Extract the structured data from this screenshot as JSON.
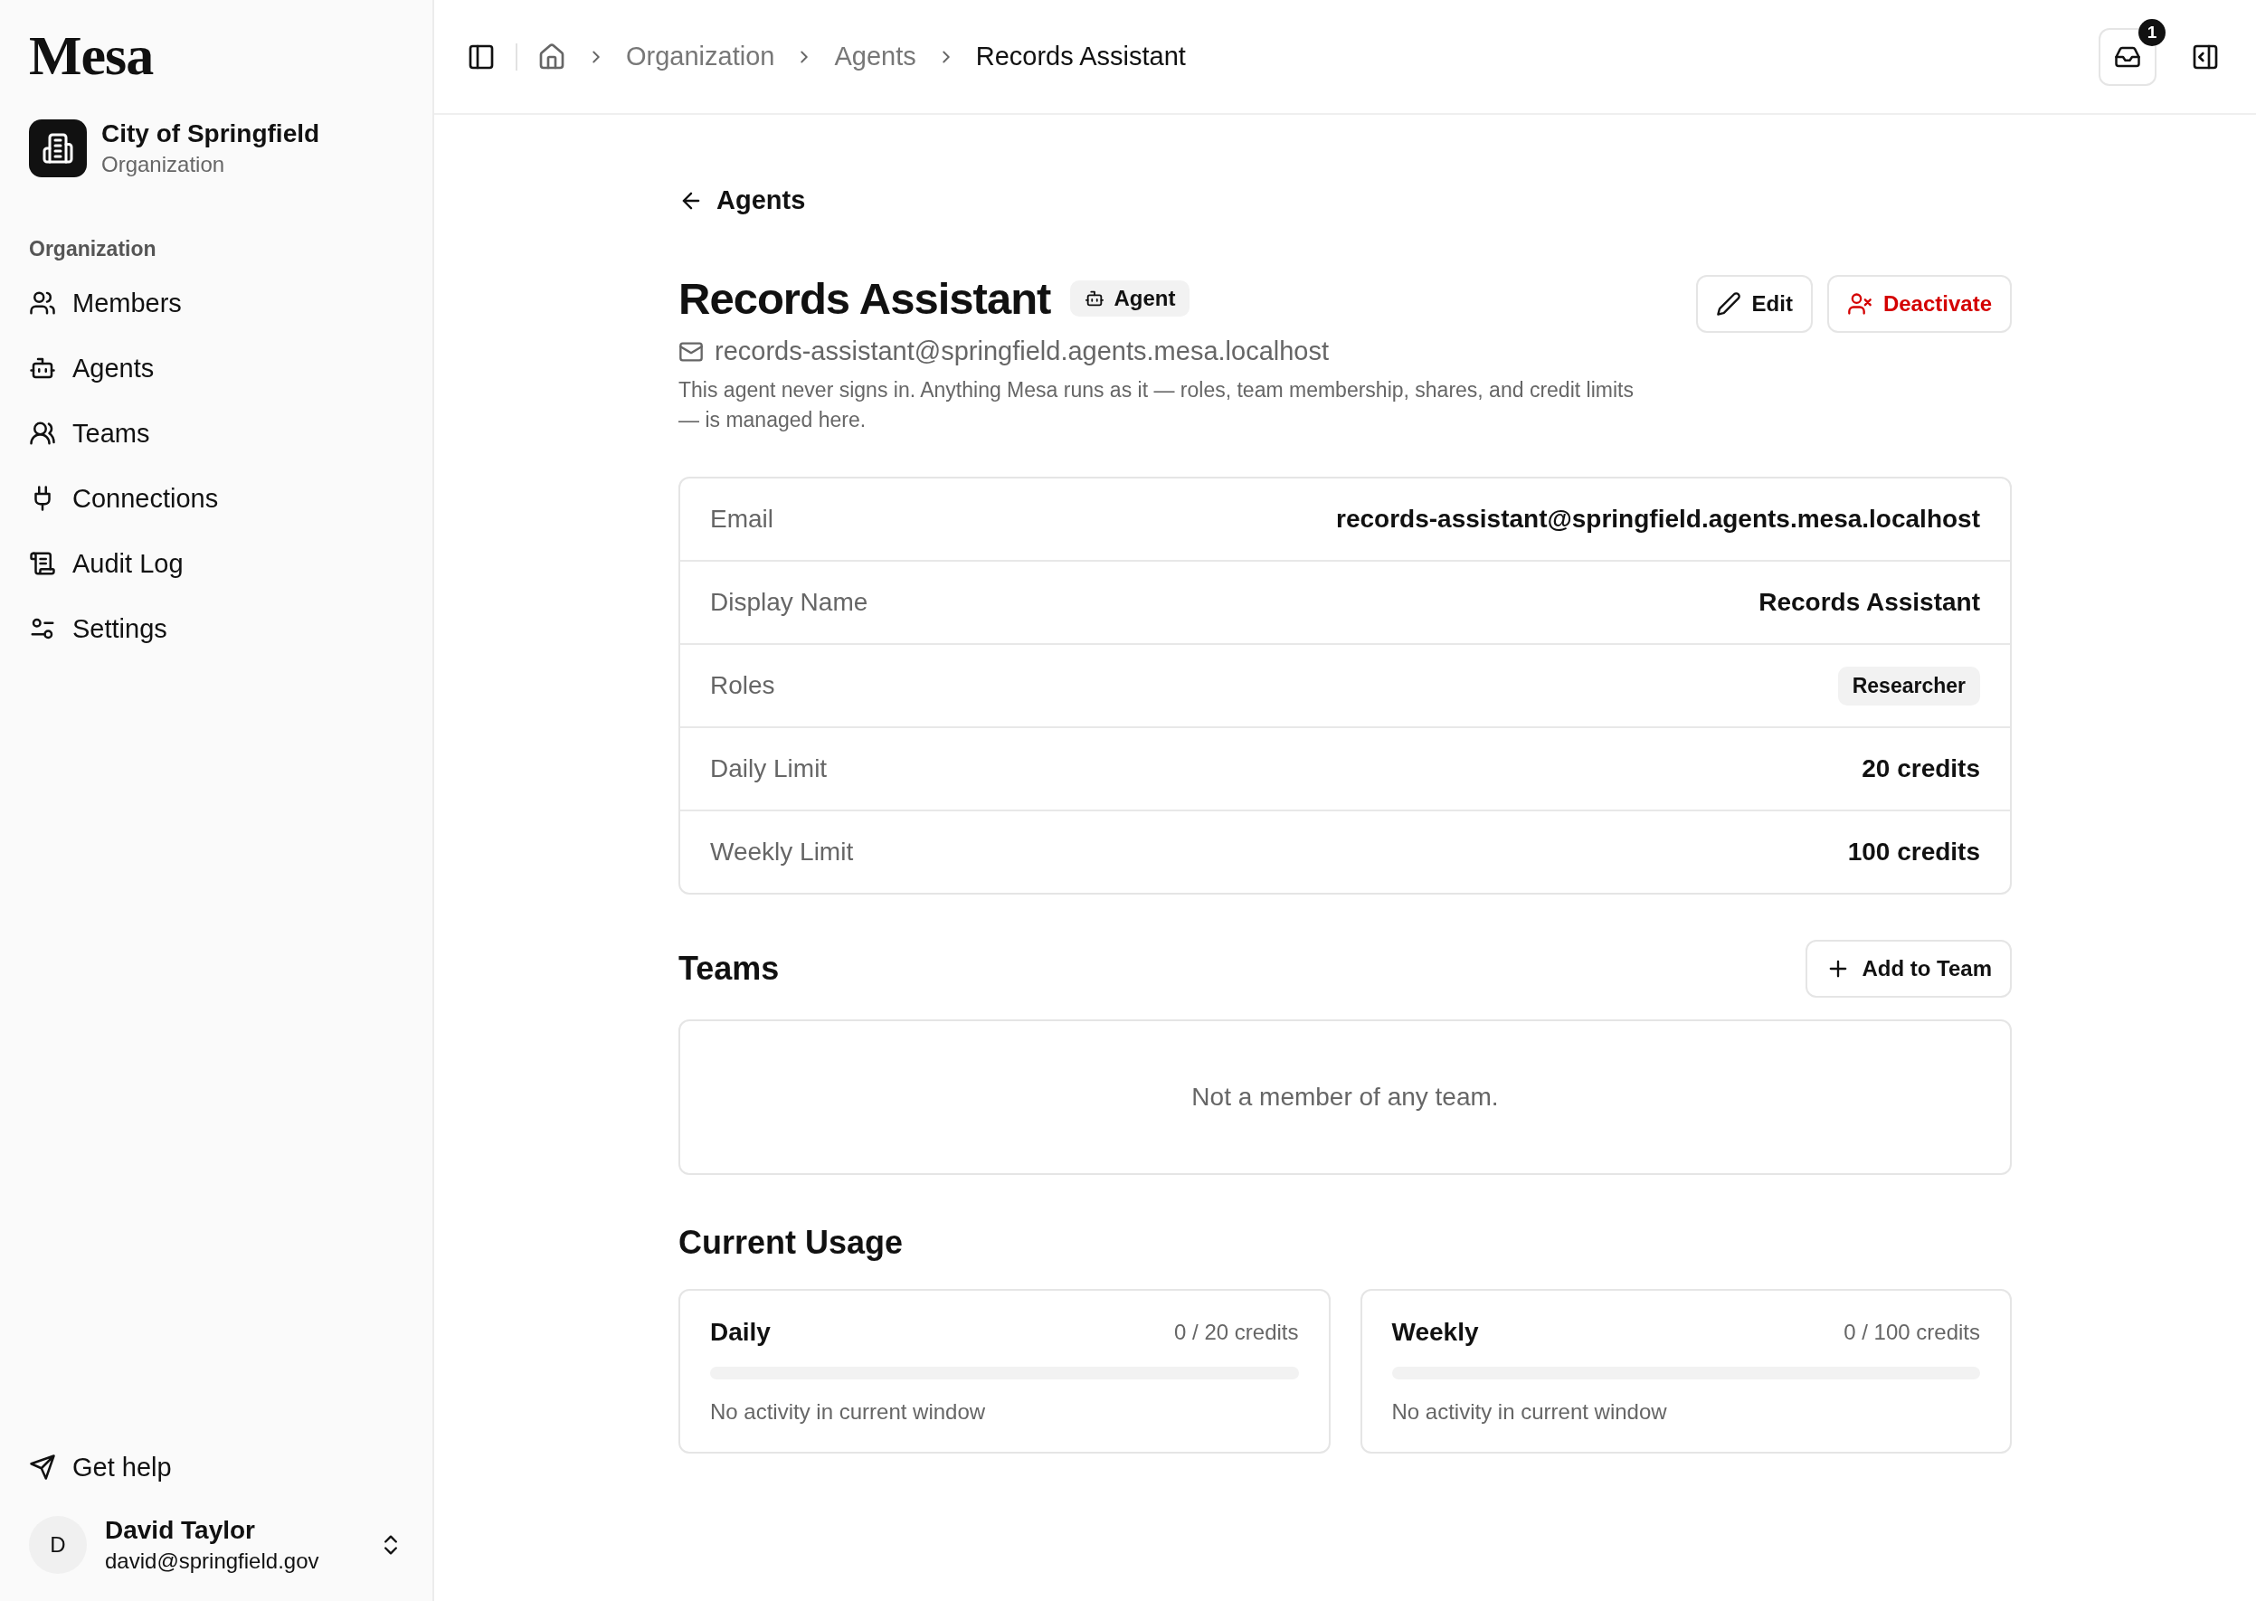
{
  "sidebar": {
    "logo": "Mesa",
    "org": {
      "name": "City of Springfield",
      "type": "Organization"
    },
    "section": "Organization",
    "items": [
      {
        "label": "Members",
        "kind": "members"
      },
      {
        "label": "Agents",
        "kind": "agents"
      },
      {
        "label": "Teams",
        "kind": "teams"
      },
      {
        "label": "Connections",
        "kind": "connections"
      },
      {
        "label": "Audit Log",
        "kind": "audit"
      },
      {
        "label": "Settings",
        "kind": "settings"
      }
    ],
    "help": "Get help",
    "user": {
      "initial": "D",
      "name": "David Taylor",
      "email": "david@springfield.gov"
    }
  },
  "header": {
    "breadcrumbs": [
      "Organization",
      "Agents",
      "Records Assistant"
    ],
    "inbox_badge": "1"
  },
  "back": "Agents",
  "agent": {
    "name": "Records Assistant",
    "badge": "Agent",
    "email": "records-assistant@springfield.agents.mesa.localhost",
    "description": "This agent never signs in. Anything Mesa runs as it — roles, team membership, shares, and credit limits — is managed here.",
    "buttons": {
      "edit": "Edit",
      "deactivate": "Deactivate"
    }
  },
  "details": [
    {
      "label": "Email",
      "value": "records-assistant@springfield.agents.mesa.localhost",
      "kind": "text"
    },
    {
      "label": "Display Name",
      "value": "Records Assistant",
      "kind": "text"
    },
    {
      "label": "Roles",
      "value": "Researcher",
      "kind": "badge"
    },
    {
      "label": "Daily Limit",
      "value": "20 credits",
      "kind": "text"
    },
    {
      "label": "Weekly Limit",
      "value": "100 credits",
      "kind": "text"
    }
  ],
  "teams": {
    "title": "Teams",
    "add_button": "Add to Team",
    "empty": "Not a member of any team."
  },
  "usage": {
    "title": "Current Usage",
    "cards": [
      {
        "label": "Daily",
        "reading": "0 / 20 credits",
        "level": 0,
        "note": "No activity in current window"
      },
      {
        "label": "Weekly",
        "reading": "0 / 100 credits",
        "level": 0,
        "note": "No activity in current window"
      }
    ]
  }
}
